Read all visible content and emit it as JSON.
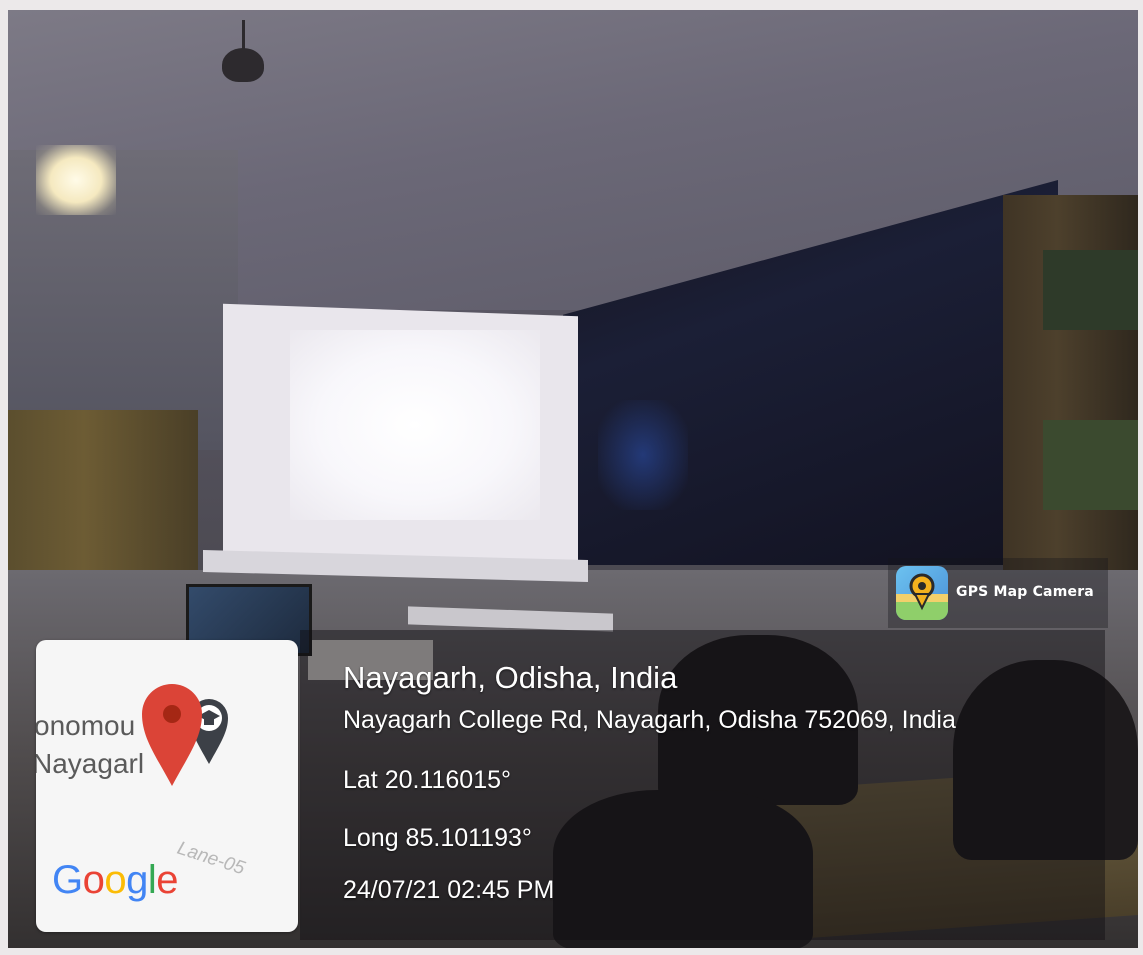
{
  "photo": {
    "description_icon": "classroom-photo"
  },
  "map_thumbnail": {
    "text_line_1": "onomou",
    "text_line_2": "Nayagarl",
    "lane_label": "Lane-05",
    "google_letters": [
      "G",
      "o",
      "o",
      "g",
      "l",
      "e"
    ],
    "pin_icon": "map-pin-icon",
    "college_icon": "graduation-cap-pin-icon"
  },
  "app_badge": {
    "icon": "gps-map-camera-icon",
    "label": "GPS Map Camera"
  },
  "location": {
    "city_line": "Nayagarh, Odisha, India",
    "address_line": "Nayagarh College Rd, Nayagarh, Odisha 752069, India",
    "latitude": "Lat 20.116015°",
    "longitude": "Long 85.101193°",
    "datetime": "24/07/21 02:45 PM"
  },
  "colors": {
    "google_blue": "#4285F4",
    "google_red": "#EA4335",
    "google_yellow": "#FBBC05",
    "google_green": "#34A853",
    "pin_red": "#DB4437"
  }
}
